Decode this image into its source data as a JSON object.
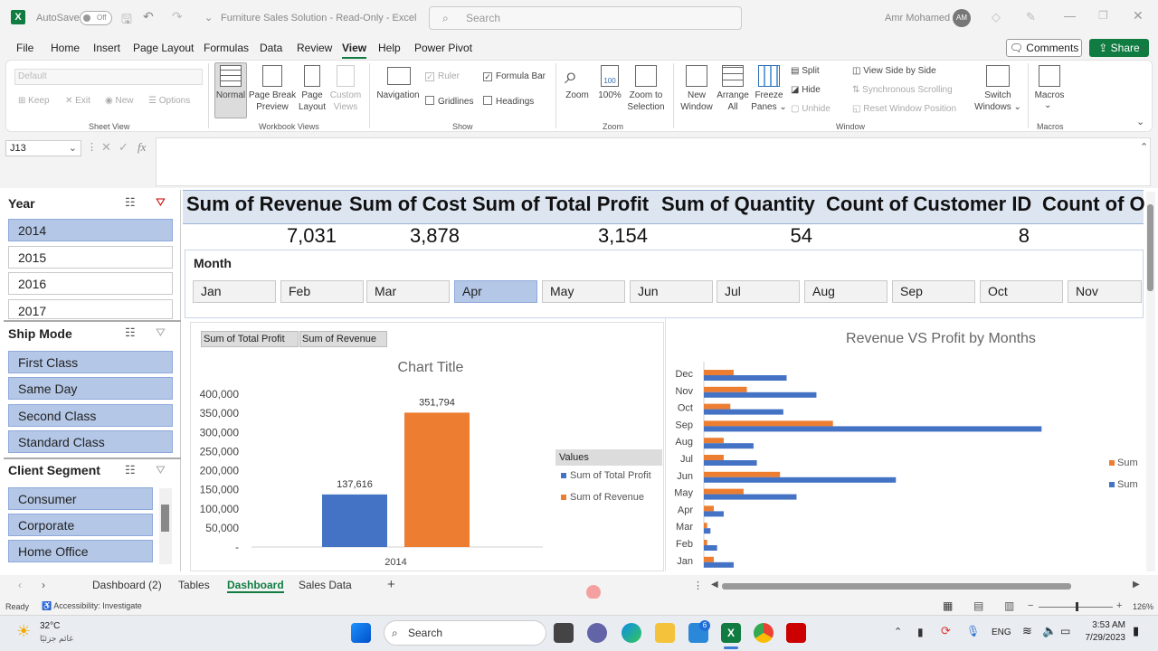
{
  "titlebar": {
    "autosave_label": "AutoSave",
    "autosave_state": "Off",
    "doc_title": "Furniture Sales Solution",
    "doc_mode": "Read-Only",
    "app_name": "Excel",
    "search_placeholder": "Search",
    "user_name": "Amr Mohamed",
    "user_initials": "AM"
  },
  "menu": {
    "tabs": [
      "File",
      "Home",
      "Insert",
      "Page Layout",
      "Formulas",
      "Data",
      "Review",
      "View",
      "Help",
      "Power Pivot"
    ],
    "active_tab": "View",
    "comments_label": "Comments",
    "share_label": "Share"
  },
  "ribbon": {
    "sheet_view": {
      "dropdown_value": "Default",
      "keep": "Keep",
      "exit": "Exit",
      "new": "New",
      "options": "Options",
      "group": "Sheet View"
    },
    "workbook_views": {
      "normal": "Normal",
      "page_break_1": "Page Break",
      "page_break_2": "Preview",
      "page_layout_1": "Page",
      "page_layout_2": "Layout",
      "custom_1": "Custom",
      "custom_2": "Views",
      "group": "Workbook Views"
    },
    "show": {
      "navigation": "Navigation",
      "ruler": "Ruler",
      "formula_bar": "Formula Bar",
      "gridlines": "Gridlines",
      "headings": "Headings",
      "group": "Show"
    },
    "zoom": {
      "zoom": "Zoom",
      "hundred": "100%",
      "zoom_sel_1": "Zoom to",
      "zoom_sel_2": "Selection",
      "group": "Zoom"
    },
    "window": {
      "new_1": "New",
      "new_2": "Window",
      "arrange_1": "Arrange",
      "arrange_2": "All",
      "freeze_1": "Freeze",
      "freeze_2": "Panes",
      "split": "Split",
      "hide": "Hide",
      "unhide": "Unhide",
      "side_by_side": "View Side by Side",
      "sync_scroll": "Synchronous Scrolling",
      "reset_pos": "Reset Window Position",
      "switch_1": "Switch",
      "switch_2": "Windows",
      "group": "Window"
    },
    "macros": {
      "macros": "Macros",
      "group": "Macros"
    }
  },
  "formula_bar": {
    "name_box": "J13",
    "fx": "fx",
    "value": ""
  },
  "slicers": {
    "year": {
      "title": "Year",
      "items": [
        "2014",
        "2015",
        "2016",
        "2017"
      ],
      "selected": "2014"
    },
    "ship_mode": {
      "title": "Ship Mode",
      "items": [
        "First Class",
        "Same Day",
        "Second Class",
        "Standard Class"
      ]
    },
    "client_segment": {
      "title": "Client Segment",
      "items": [
        "Consumer",
        "Corporate",
        "Home Office"
      ]
    }
  },
  "kpis": {
    "headers": [
      "Sum of Revenue",
      "Sum of Cost",
      "Sum of Total Profit",
      "Sum of Quantity",
      "Count of Customer ID",
      "Count of O"
    ],
    "values": [
      "7,031",
      "3,878",
      "3,154",
      "54",
      "8"
    ]
  },
  "month_slicer": {
    "title": "Month",
    "items": [
      "Jan",
      "Feb",
      "Mar",
      "Apr",
      "May",
      "Jun",
      "Jul",
      "Aug",
      "Sep",
      "Oct",
      "Nov"
    ],
    "selected": "Apr"
  },
  "chart_data": [
    {
      "type": "bar",
      "title": "Chart Title",
      "field_buttons": [
        "Sum of Total Profit",
        "Sum of Revenue"
      ],
      "legend_title": "Values",
      "categories": [
        "2014"
      ],
      "series": [
        {
          "name": "Sum of Total Profit",
          "values": [
            137616
          ],
          "color": "#4472c4"
        },
        {
          "name": "Sum of Revenue",
          "values": [
            351794
          ],
          "color": "#ed7d31"
        }
      ],
      "data_labels": [
        "137,616",
        "351,794"
      ],
      "yticks": [
        "400,000",
        "350,000",
        "300,000",
        "250,000",
        "200,000",
        "150,000",
        "100,000",
        "50,000",
        "-"
      ],
      "ylim": [
        0,
        400000
      ]
    },
    {
      "type": "bar",
      "orientation": "horizontal",
      "title": "Revenue VS Profit by Months",
      "categories": [
        "Dec",
        "Nov",
        "Oct",
        "Sep",
        "Aug",
        "Jul",
        "Jun",
        "May",
        "Apr",
        "Mar",
        "Feb",
        "Jan"
      ],
      "series": [
        {
          "name": "Sum",
          "color": "#ed7d31",
          "values": [
            9,
            13,
            8,
            39,
            6,
            6,
            23,
            12,
            3,
            1,
            1,
            3
          ]
        },
        {
          "name": "Sum",
          "color": "#4472c4",
          "values": [
            25,
            34,
            24,
            102,
            15,
            16,
            58,
            28,
            6,
            2,
            4,
            9
          ]
        }
      ],
      "legend_labels": [
        "Sum",
        "Sum"
      ]
    }
  ],
  "sheet_tabs": {
    "tabs": [
      "Dashboard (2)",
      "Tables",
      "Dashboard",
      "Sales Data"
    ],
    "active": "Dashboard"
  },
  "status": {
    "ready": "Ready",
    "accessibility": "Accessibility: Investigate",
    "zoom": "126%"
  },
  "taskbar": {
    "weather_temp": "32°C",
    "weather_desc": "غائم جزئيًا",
    "search": "Search",
    "lang": "ENG",
    "time": "3:53 AM",
    "date": "7/29/2023",
    "badge": "6"
  }
}
